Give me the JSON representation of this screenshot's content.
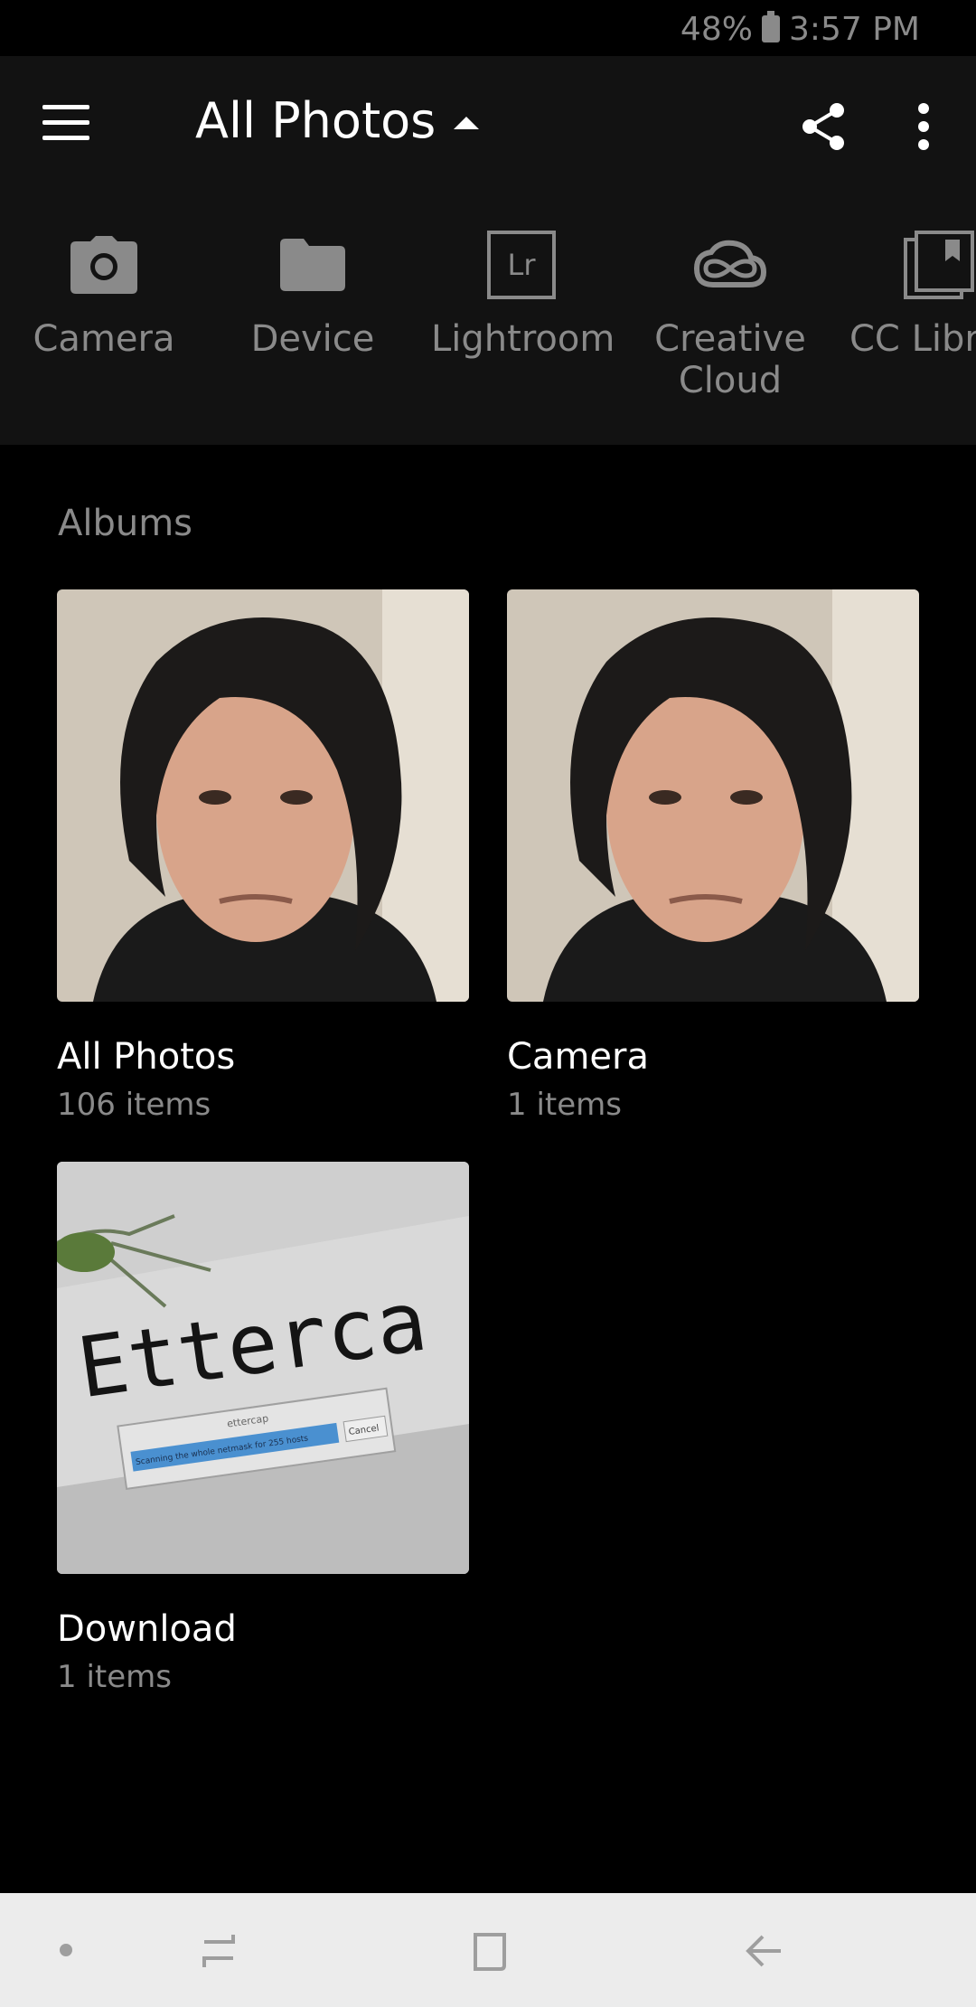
{
  "status_bar": {
    "battery": "48%",
    "time": "3:57 PM"
  },
  "app_bar": {
    "title": "All Photos"
  },
  "sources": [
    {
      "label": "Camera",
      "icon": "camera-icon"
    },
    {
      "label": "Device",
      "icon": "folder-icon"
    },
    {
      "label": "Lightroom",
      "icon": "lightroom-icon",
      "icon_text": "Lr"
    },
    {
      "label": "Creative\nCloud",
      "icon": "creative-cloud-icon"
    },
    {
      "label": "CC Libr",
      "icon": "cc-libraries-icon"
    }
  ],
  "albums_section": {
    "header": "Albums",
    "items": [
      {
        "name": "All Photos",
        "count": "106 items"
      },
      {
        "name": "Camera",
        "count": "1 items"
      },
      {
        "name": "Download",
        "count": "1 items",
        "thumb_text": "Etterca",
        "dialog_title": "ettercap",
        "dialog_text": "Scanning the whole netmask for 255 hosts",
        "dialog_button": "Cancel"
      }
    ]
  },
  "colors": {
    "background": "#000000",
    "bar": "#121212",
    "muted_text": "#8a8a8a",
    "nav_bar": "#ececec"
  }
}
